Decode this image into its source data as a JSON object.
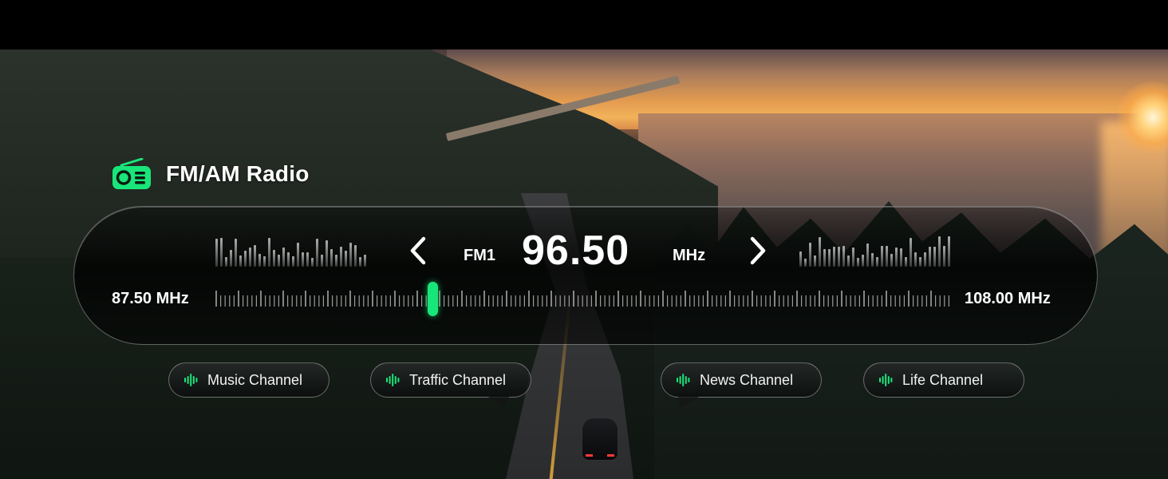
{
  "app": {
    "title": "FM/AM Radio",
    "accent_color": "#19e67a",
    "icon": "radio-icon"
  },
  "tuner": {
    "band": "FM1",
    "frequency": "96.50",
    "unit": "MHz",
    "range_min": "87.50 MHz",
    "range_max": "108.00 MHz",
    "prev_icon": "chevron-left-icon",
    "next_icon": "chevron-right-icon"
  },
  "channels": [
    {
      "label": "Music Channel",
      "icon": "waveform-icon"
    },
    {
      "label": "Traffic Channel",
      "icon": "waveform-icon"
    },
    {
      "label": "News Channel",
      "icon": "waveform-icon"
    },
    {
      "label": "Life Channel",
      "icon": "waveform-icon"
    }
  ]
}
